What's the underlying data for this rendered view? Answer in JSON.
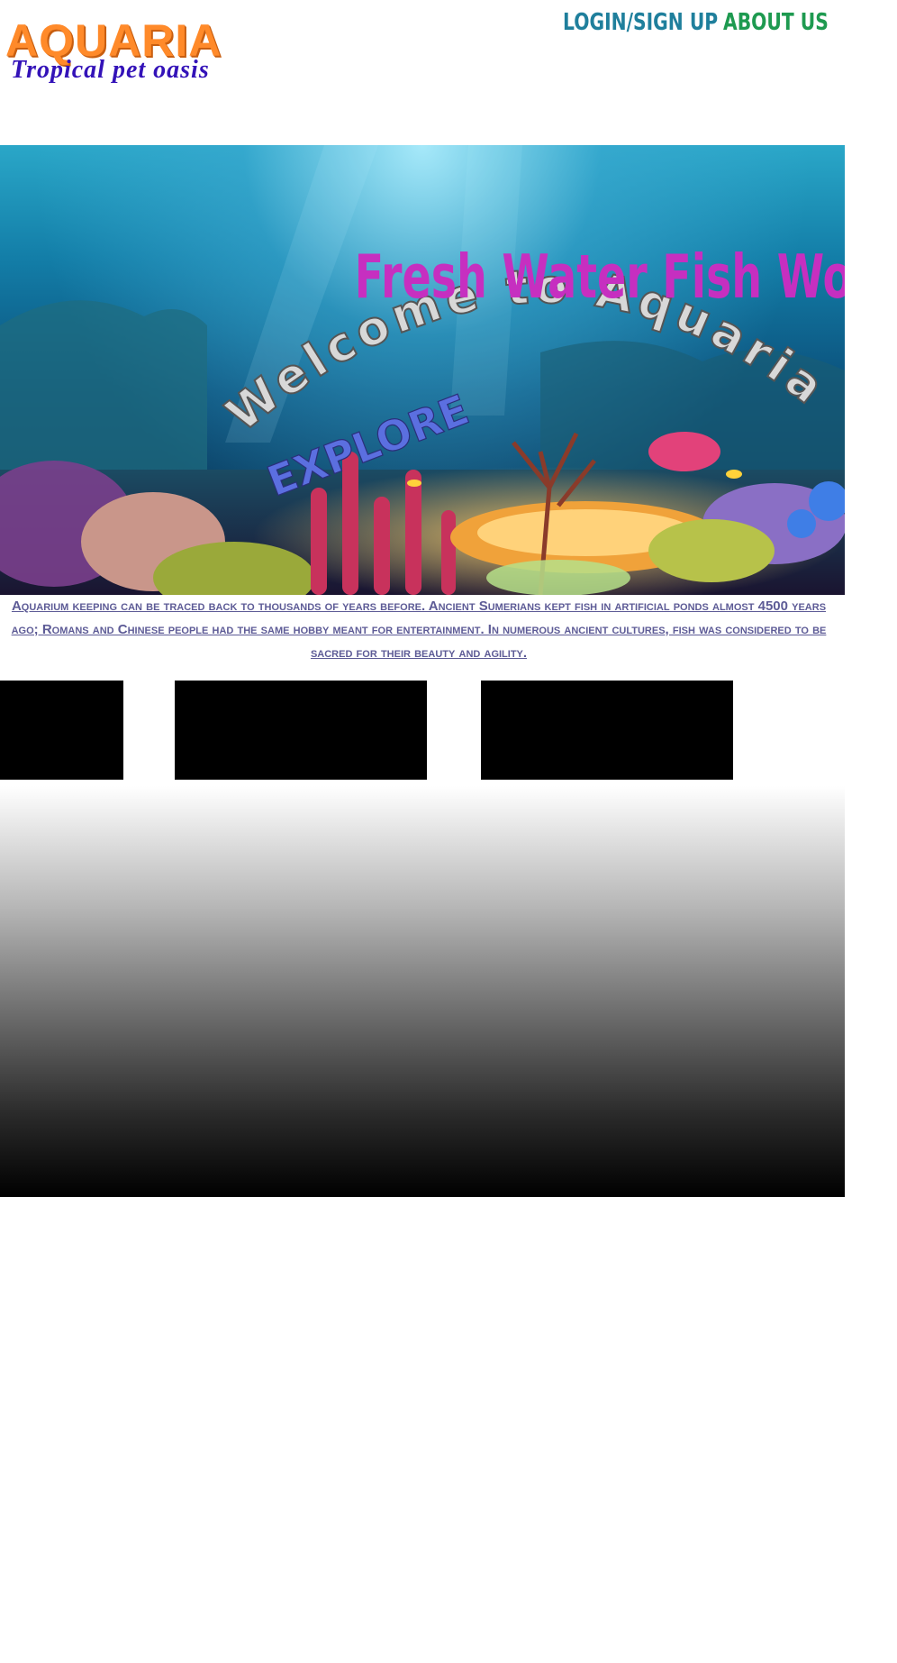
{
  "logo": {
    "title": "AQUARIA",
    "tagline": "Tropical pet oasis"
  },
  "nav": {
    "login": "LOGIN/SIGN UP",
    "about": "ABOUT US"
  },
  "banner": {
    "headline": "Welcome to Aquaria",
    "subheadline": "Fresh Water Fish World",
    "explore": "EXPLORE"
  },
  "info": {
    "text": "Aquarium keeping can be traced back to thousands of years before. Ancient Sumerians kept fish in artificial ponds almost 4500 years ago; Romans and Chinese people had the same hobby meant for entertainment. In numerous ancient cultures, fish was considered to be sacred for their beauty and agility."
  },
  "colors": {
    "logo_orange": "#ff8a2a",
    "tagline_blue": "#3312b8",
    "login_teal": "#1f7f9c",
    "about_green": "#1e9a50",
    "headline_magenta": "#c62fc0",
    "explore_blue": "#5b6fe0",
    "info_text": "#5d5b96"
  }
}
